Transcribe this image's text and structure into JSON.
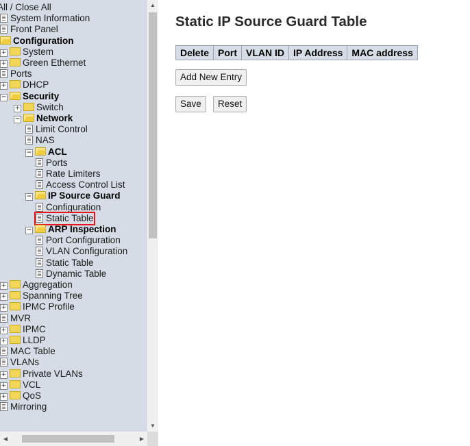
{
  "nav": {
    "items": [
      {
        "label": "All / Close All",
        "icon": "none",
        "level": 0,
        "bold": false
      },
      {
        "label": "System Information",
        "icon": "doc",
        "level": 0,
        "bold": false
      },
      {
        "label": "Front Panel",
        "icon": "doc",
        "level": 0,
        "bold": false
      },
      {
        "label": "Configuration",
        "icon": "folder-open",
        "level": 0,
        "bold": true
      },
      {
        "label": "System",
        "icon": "folder",
        "expander": "+",
        "level": 0,
        "bold": false
      },
      {
        "label": "Green Ethernet",
        "icon": "folder",
        "expander": "+",
        "level": 0,
        "bold": false
      },
      {
        "label": "Ports",
        "icon": "doc",
        "level": 0,
        "bold": false
      },
      {
        "label": "DHCP",
        "icon": "folder",
        "expander": "+",
        "level": 0,
        "bold": false
      },
      {
        "label": "Security",
        "icon": "folder-open",
        "expander": "−",
        "level": 0,
        "bold": true
      },
      {
        "label": "Switch",
        "icon": "folder",
        "expander": "+",
        "level": 1,
        "bold": false
      },
      {
        "label": "Network",
        "icon": "folder-open",
        "expander": "−",
        "level": 1,
        "bold": true
      },
      {
        "label": "Limit Control",
        "icon": "doc",
        "level": 2,
        "bold": false
      },
      {
        "label": "NAS",
        "icon": "doc",
        "level": 2,
        "bold": false
      },
      {
        "label": "ACL",
        "icon": "folder-open",
        "expander": "−",
        "level": 2,
        "bold": true
      },
      {
        "label": "Ports",
        "icon": "doc",
        "level": 3,
        "bold": false
      },
      {
        "label": "Rate Limiters",
        "icon": "doc",
        "level": 3,
        "bold": false
      },
      {
        "label": "Access Control List",
        "icon": "doc",
        "level": 3,
        "bold": false
      },
      {
        "label": "IP Source Guard",
        "icon": "folder-open",
        "expander": "−",
        "level": 2,
        "bold": true
      },
      {
        "label": "Configuration",
        "icon": "doc",
        "level": 3,
        "bold": false
      },
      {
        "label": "Static Table",
        "icon": "doc",
        "level": 3,
        "bold": false,
        "selected": true
      },
      {
        "label": "ARP Inspection",
        "icon": "folder-open",
        "expander": "−",
        "level": 2,
        "bold": true
      },
      {
        "label": "Port Configuration",
        "icon": "doc",
        "level": 3,
        "bold": false
      },
      {
        "label": "VLAN Configuration",
        "icon": "doc",
        "level": 3,
        "bold": false
      },
      {
        "label": "Static Table",
        "icon": "doc",
        "level": 3,
        "bold": false
      },
      {
        "label": "Dynamic Table",
        "icon": "doc",
        "level": 3,
        "bold": false
      },
      {
        "label": "Aggregation",
        "icon": "folder",
        "expander": "+",
        "level": 0,
        "bold": false
      },
      {
        "label": "Spanning Tree",
        "icon": "folder",
        "expander": "+",
        "level": 0,
        "bold": false
      },
      {
        "label": "IPMC Profile",
        "icon": "folder",
        "expander": "+",
        "level": 0,
        "bold": false
      },
      {
        "label": "MVR",
        "icon": "doc",
        "level": 0,
        "bold": false
      },
      {
        "label": "IPMC",
        "icon": "folder",
        "expander": "+",
        "level": 0,
        "bold": false
      },
      {
        "label": "LLDP",
        "icon": "folder",
        "expander": "+",
        "level": 0,
        "bold": false
      },
      {
        "label": "MAC Table",
        "icon": "doc",
        "level": 0,
        "bold": false
      },
      {
        "label": "VLANs",
        "icon": "doc",
        "level": 0,
        "bold": false
      },
      {
        "label": "Private VLANs",
        "icon": "folder",
        "expander": "+",
        "level": 0,
        "bold": false
      },
      {
        "label": "VCL",
        "icon": "folder",
        "expander": "+",
        "level": 0,
        "bold": false
      },
      {
        "label": "QoS",
        "icon": "folder",
        "expander": "+",
        "level": 0,
        "bold": false
      },
      {
        "label": "Mirroring",
        "icon": "doc",
        "level": 0,
        "bold": false
      }
    ]
  },
  "main": {
    "title": "Static IP Source Guard Table",
    "columns": [
      "Delete",
      "Port",
      "VLAN ID",
      "IP Address",
      "MAC address"
    ],
    "add_label": "Add New Entry",
    "save_label": "Save",
    "reset_label": "Reset"
  },
  "colors": {
    "nav_background": "#d5dce5",
    "table_header": "#d6dde6",
    "selection_outline": "#e8141b"
  }
}
